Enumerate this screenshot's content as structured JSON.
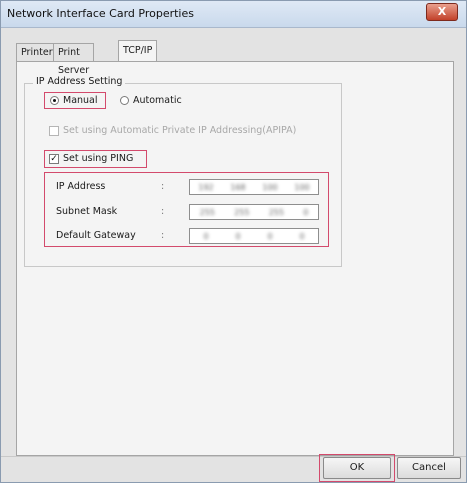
{
  "window": {
    "title": "Network Interface Card Properties",
    "close_glyph": "X"
  },
  "tabs": [
    {
      "label": "Printer"
    },
    {
      "label": "Print Server"
    },
    {
      "label": "TCP/IP"
    }
  ],
  "ip_group": {
    "title": "IP Address Setting",
    "manual_label": "Manual",
    "automatic_label": "Automatic",
    "apipa_label": "Set using Automatic Private IP Addressing(APIPA)",
    "ping_label": "Set using PING",
    "check_glyph": "✓",
    "colon": ":",
    "fields": [
      {
        "label": "IP Address",
        "octets": [
          "192",
          "168",
          "100",
          "100"
        ]
      },
      {
        "label": "Subnet Mask",
        "octets": [
          "255",
          "255",
          "255",
          "0"
        ]
      },
      {
        "label": "Default Gateway",
        "octets": [
          "0",
          "0",
          "0",
          "0"
        ]
      }
    ]
  },
  "footer": {
    "ok_label": "OK",
    "cancel_label": "Cancel"
  },
  "colors": {
    "highlight": "#d34a6c",
    "panel": "#f4f4f4"
  }
}
